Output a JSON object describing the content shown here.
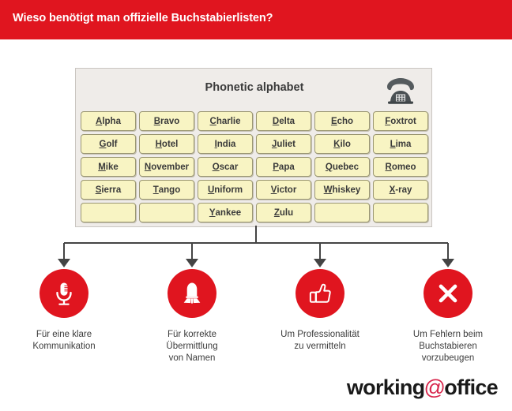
{
  "header": {
    "title": "Wieso benötigt man offizielle Buchstabierlisten?",
    "background_color": "#e0151f",
    "text_color": "#ffffff"
  },
  "alphabet_panel": {
    "title": "Phonetic alphabet",
    "icon": "telephone-icon",
    "panel_background": "#efece9",
    "cell_background": "#f8f4c3",
    "cell_border": "#9b9772",
    "columns": 6,
    "rows": 5,
    "cells": [
      {
        "first": "A",
        "rest": "lpha"
      },
      {
        "first": "B",
        "rest": "ravo"
      },
      {
        "first": "C",
        "rest": "harlie"
      },
      {
        "first": "D",
        "rest": "elta"
      },
      {
        "first": "E",
        "rest": "cho"
      },
      {
        "first": "F",
        "rest": "oxtrot"
      },
      {
        "first": "G",
        "rest": "olf"
      },
      {
        "first": "H",
        "rest": "otel"
      },
      {
        "first": "I",
        "rest": "ndia"
      },
      {
        "first": "J",
        "rest": "uliet"
      },
      {
        "first": "K",
        "rest": "ilo"
      },
      {
        "first": "L",
        "rest": "ima"
      },
      {
        "first": "M",
        "rest": "ike"
      },
      {
        "first": "N",
        "rest": "ovember"
      },
      {
        "first": "O",
        "rest": "scar"
      },
      {
        "first": "P",
        "rest": "apa"
      },
      {
        "first": "Q",
        "rest": "uebec"
      },
      {
        "first": "R",
        "rest": "omeo"
      },
      {
        "first": "S",
        "rest": "ierra"
      },
      {
        "first": "T",
        "rest": "ango"
      },
      {
        "first": "U",
        "rest": "niform"
      },
      {
        "first": "V",
        "rest": "ictor"
      },
      {
        "first": "W",
        "rest": "hiskey"
      },
      {
        "first": "X",
        "rest": "-ray"
      },
      {
        "first": "",
        "rest": ""
      },
      {
        "first": "",
        "rest": ""
      },
      {
        "first": "Y",
        "rest": "ankee"
      },
      {
        "first": "Z",
        "rest": "ulu"
      },
      {
        "first": "",
        "rest": ""
      },
      {
        "first": "",
        "rest": ""
      }
    ]
  },
  "reasons": [
    {
      "icon": "microphone-icon",
      "caption": "Für eine klare\nKommunikation"
    },
    {
      "icon": "bell-icon",
      "caption": "Für korrekte\nÜbermittlung\nvon Namen"
    },
    {
      "icon": "thumbs-up-icon",
      "caption": "Um Professionalität\nzu vermitteln"
    },
    {
      "icon": "cross-icon",
      "caption": "Um Fehlern beim\nBuchstabieren\nvorzubeugen"
    }
  ],
  "logo": {
    "part1": "working",
    "at": "@",
    "part2": "office",
    "at_color": "#d8254b"
  }
}
